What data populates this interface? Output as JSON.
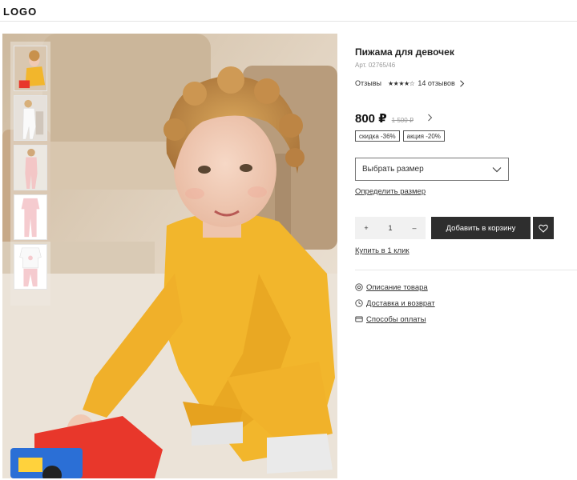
{
  "header": {
    "logo": "LOGO"
  },
  "product": {
    "title": "Пижама для девочек",
    "sku": "Арт. 02765/46",
    "reviews_label": "Отзывы",
    "rating_stars": "★★★★☆",
    "reviews_count": "14 отзывов",
    "price": "800 ₽",
    "old_price": "1 500 ₽",
    "badges": [
      "скидка -36%",
      "акция -20%"
    ]
  },
  "gallery": {
    "thumbnails": [
      "child-yellow-outfit",
      "girl-white-pajama",
      "girl-pink-pajama",
      "pink-pajama-flat",
      "pajama-set-flat"
    ],
    "main_image": "child-in-yellow-outfit-playing-with-toy-truck"
  },
  "size": {
    "placeholder": "Выбрать размер",
    "determine_link": "Определить размер"
  },
  "cart": {
    "minus": "+",
    "quantity": "1",
    "plus": "–",
    "add_to_cart": "Добавить в корзину",
    "buy_one_click": "Купить в 1 клик"
  },
  "info_links": [
    {
      "label": "Описание товара",
      "icon": "info-circle-icon"
    },
    {
      "label": "Доставка и возврат",
      "icon": "clock-icon"
    },
    {
      "label": "Способы оплаты",
      "icon": "card-icon"
    }
  ],
  "colors": {
    "accent_dark": "#2e2e2e",
    "yellow_outfit": "#f2b62c",
    "text": "#222222",
    "muted": "#9a9a9a"
  }
}
